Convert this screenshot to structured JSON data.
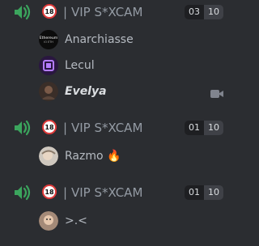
{
  "channels": [
    {
      "age_badge": "18",
      "separator": "|",
      "name": "VIP S*XCAM",
      "count_current": "03",
      "count_limit": "10",
      "members": [
        {
          "name": "Anarchiasse",
          "avatar_text": "Ethereum\nIO ETH",
          "icon": "ethereum-avatar"
        },
        {
          "name": "Lecul",
          "icon": "purple-box-avatar"
        },
        {
          "name": "Evelya",
          "icon": "photo-avatar",
          "streaming": true
        }
      ]
    },
    {
      "age_badge": "18",
      "separator": "|",
      "name": "VIP S*XCAM",
      "count_current": "01",
      "count_limit": "10",
      "members": [
        {
          "name": "Razmo 🔥",
          "icon": "photo-avatar"
        }
      ]
    },
    {
      "age_badge": "18",
      "separator": "|",
      "name": "VIP S*XCAM",
      "count_current": "01",
      "count_limit": "10",
      "members": [
        {
          "name": ">.<",
          "icon": "photo-avatar"
        }
      ]
    }
  ],
  "colors": {
    "background": "#2b2d31",
    "channel_icon": "#3ba55d",
    "age_badge_border": "#e03a3a",
    "muted_text": "#949ba4",
    "member_text": "#b5bac1"
  },
  "icons": {
    "channel": "voice-speaker-icon",
    "camera": "video-camera-icon"
  }
}
